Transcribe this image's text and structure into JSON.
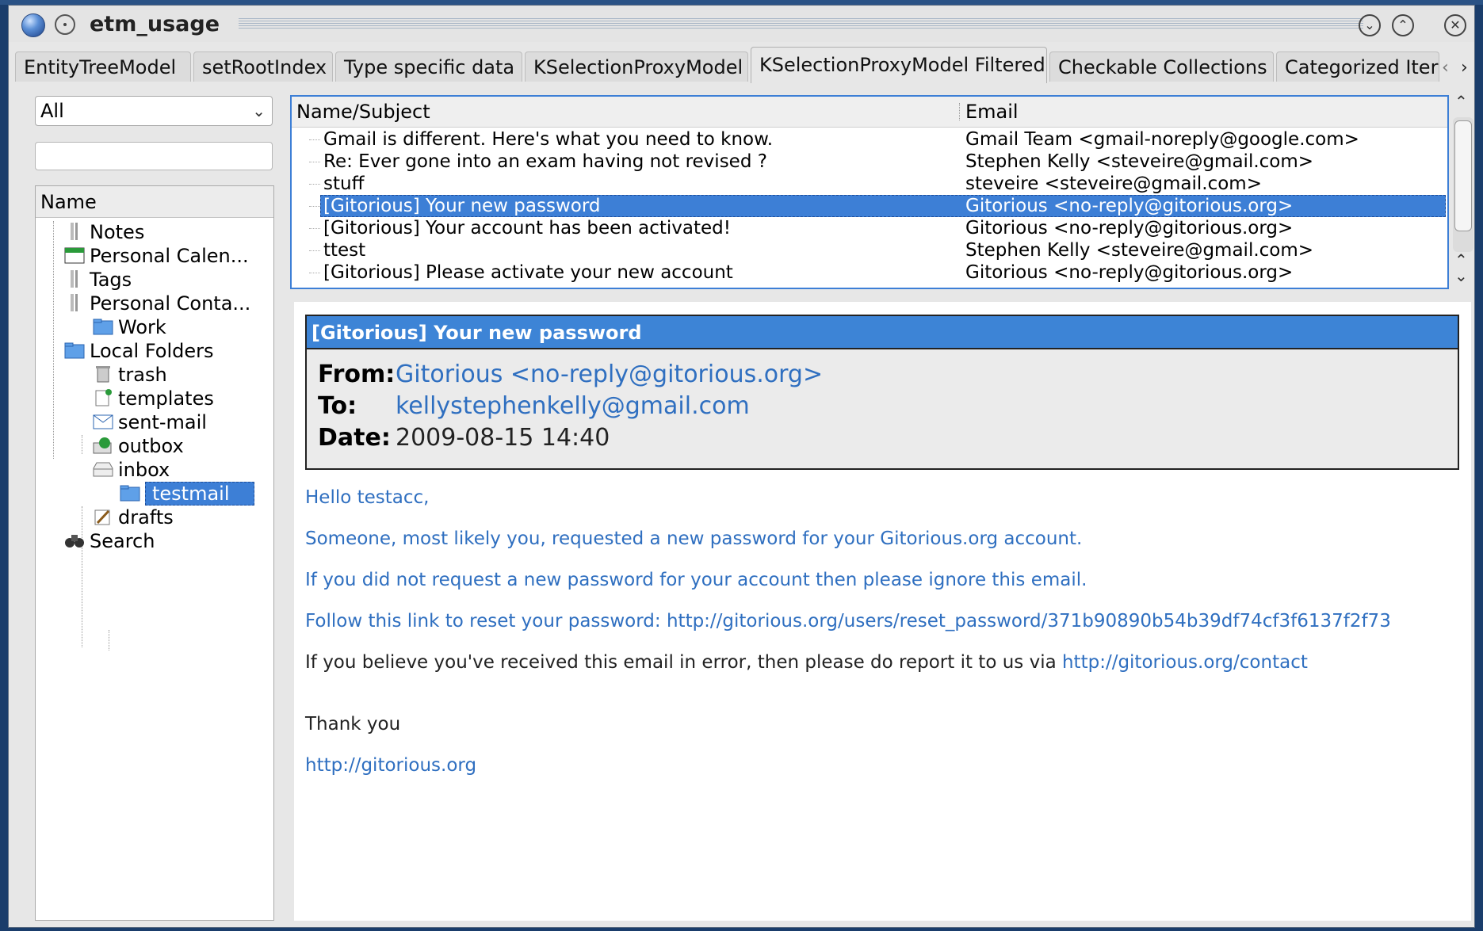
{
  "window": {
    "title": "etm_usage"
  },
  "tabs": [
    {
      "label": "EntityTreeModel"
    },
    {
      "label": "setRootIndex"
    },
    {
      "label": "Type specific data"
    },
    {
      "label": "KSelectionProxyModel"
    },
    {
      "label": "KSelectionProxyModel Filtered"
    },
    {
      "label": "Checkable Collections"
    },
    {
      "label": "Categorized Iter"
    }
  ],
  "filter": {
    "combo_value": "All",
    "search_value": ""
  },
  "tree": {
    "header": "Name",
    "items": [
      {
        "label": "Notes",
        "icon": "notes-icon"
      },
      {
        "label": "Personal Calen...",
        "icon": "calendar-icon"
      },
      {
        "label": "Tags",
        "icon": "tags-icon"
      },
      {
        "label": "Personal Conta...",
        "icon": "contacts-icon"
      },
      {
        "label": "Work",
        "icon": "folder-icon"
      },
      {
        "label": "Local Folders",
        "icon": "folder-icon"
      },
      {
        "label": "trash",
        "icon": "trash-icon"
      },
      {
        "label": "templates",
        "icon": "templates-icon"
      },
      {
        "label": "sent-mail",
        "icon": "sent-mail-icon"
      },
      {
        "label": "outbox",
        "icon": "outbox-icon"
      },
      {
        "label": "inbox",
        "icon": "inbox-icon"
      },
      {
        "label": "testmail",
        "icon": "folder-icon"
      },
      {
        "label": "drafts",
        "icon": "drafts-icon"
      },
      {
        "label": "Search",
        "icon": "search-icon"
      }
    ]
  },
  "messages": {
    "columns": {
      "name": "Name/Subject",
      "email": "Email"
    },
    "rows": [
      {
        "subject": "Gmail is different. Here's what you need to know.",
        "email": "Gmail Team <gmail-noreply@google.com>"
      },
      {
        "subject": "Re: Ever gone into an exam having not revised ?",
        "email": "Stephen Kelly <steveire@gmail.com>"
      },
      {
        "subject": "stuff",
        "email": "steveire <steveire@gmail.com>"
      },
      {
        "subject": "[Gitorious] Your new password",
        "email": "Gitorious <no-reply@gitorious.org>"
      },
      {
        "subject": "[Gitorious] Your account has been activated!",
        "email": "Gitorious <no-reply@gitorious.org>"
      },
      {
        "subject": "ttest",
        "email": "Stephen Kelly <steveire@gmail.com>"
      },
      {
        "subject": "[Gitorious] Please activate your new account",
        "email": "Gitorious <no-reply@gitorious.org>"
      }
    ]
  },
  "preview": {
    "subject": "[Gitorious] Your new password",
    "from_label": "From:",
    "from": "Gitorious <no-reply@gitorious.org>",
    "to_label": "To:",
    "to": "kellystephenkelly@gmail.com",
    "date_label": "Date:",
    "date": "2009-08-15 14:40",
    "body": {
      "greeting": "Hello testacc,",
      "line1": "Someone, most likely you, requested a new password for your Gitorious.org account.",
      "line2": "If you did not request a new password for your account then please ignore this email.",
      "line3": "Follow this link to reset your password: http://gitorious.org/users/reset_password/371b90890b54b39df74cf3f6137f2f73",
      "line4_text": "If you believe you've received this email in error, then please do report it to us via ",
      "line4_link": "http://gitorious.org/contact",
      "thanks": "Thank you",
      "signature_link": "http://gitorious.org"
    }
  },
  "colors": {
    "selection": "#3d7fd6",
    "link": "#2f6fc0",
    "subject_bar": "#3d84d6"
  }
}
